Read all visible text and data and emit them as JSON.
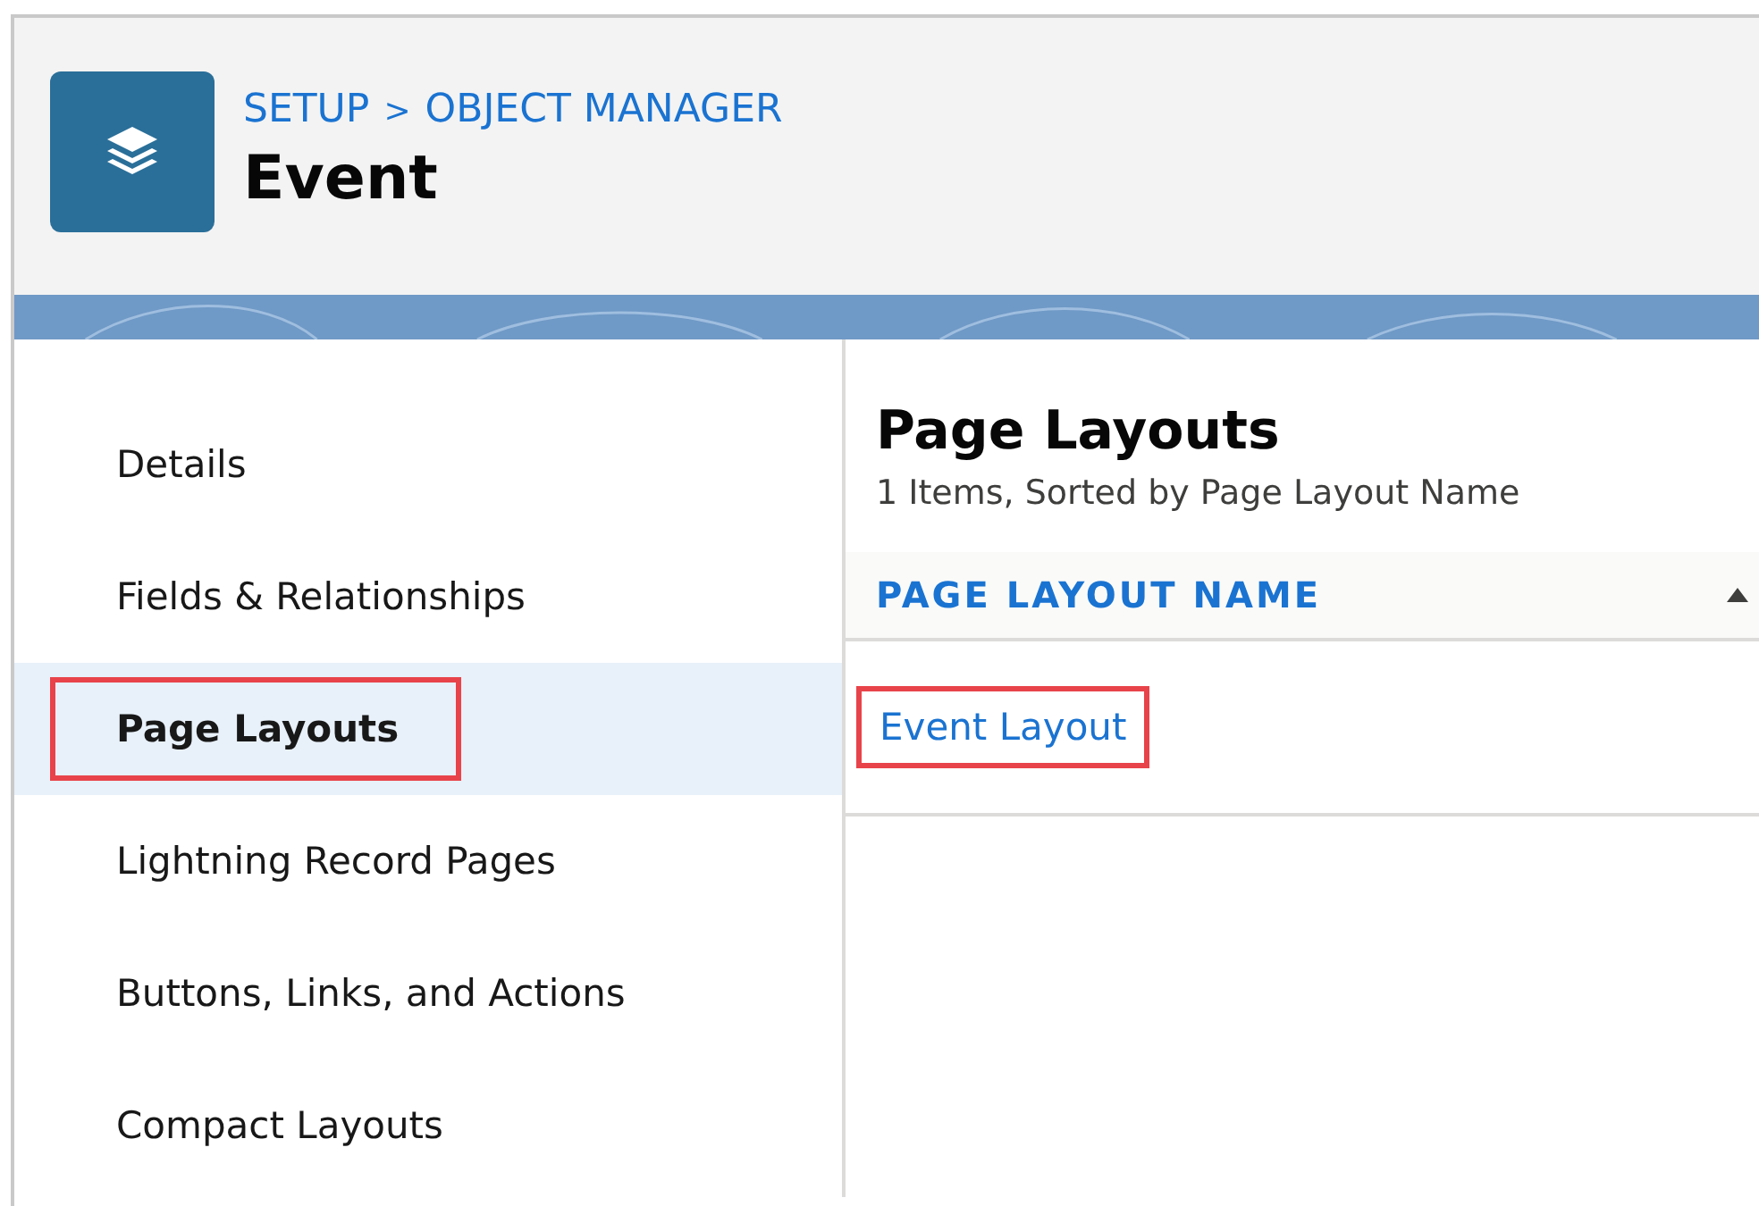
{
  "header": {
    "breadcrumb": [
      {
        "label": "SETUP"
      },
      {
        "label": "OBJECT MANAGER"
      }
    ],
    "separator": ">",
    "title": "Event"
  },
  "sidebar": {
    "items": [
      {
        "label": "Details",
        "selected": false,
        "highlighted": false
      },
      {
        "label": "Fields & Relationships",
        "selected": false,
        "highlighted": false
      },
      {
        "label": "Page Layouts",
        "selected": true,
        "highlighted": true
      },
      {
        "label": "Lightning Record Pages",
        "selected": false,
        "highlighted": false
      },
      {
        "label": "Buttons, Links, and Actions",
        "selected": false,
        "highlighted": false
      },
      {
        "label": "Compact Layouts",
        "selected": false,
        "highlighted": false
      }
    ]
  },
  "main": {
    "title": "Page Layouts",
    "subtitle": "1 Items, Sorted by Page Layout Name",
    "table": {
      "columns": [
        {
          "label": "PAGE LAYOUT NAME",
          "sorted": true
        }
      ],
      "rows": [
        {
          "name": "Event Layout",
          "highlighted": true
        }
      ]
    }
  }
}
